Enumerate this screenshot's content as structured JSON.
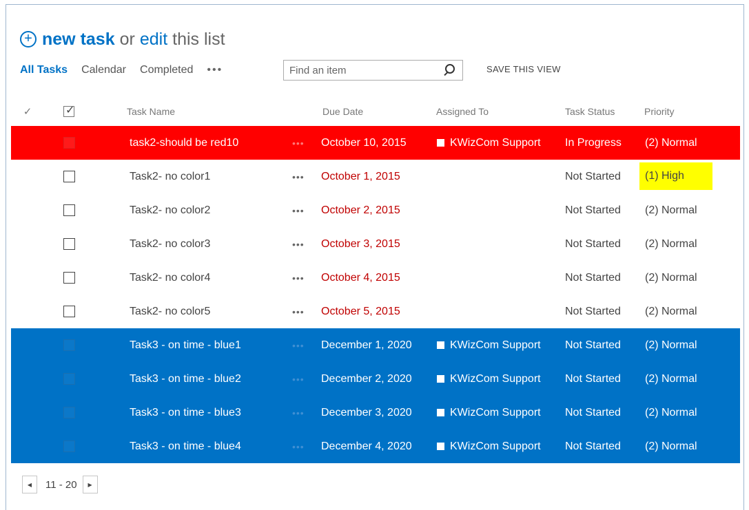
{
  "header": {
    "new_task_label": "new task",
    "or_text": "or",
    "edit_label": "edit",
    "this_list_text": "this list"
  },
  "views": {
    "all_tasks": "All Tasks",
    "calendar": "Calendar",
    "completed": "Completed",
    "more": "•••"
  },
  "search": {
    "placeholder": "Find an item"
  },
  "save_view_label": "SAVE THIS VIEW",
  "columns": {
    "task_name": "Task Name",
    "due_date": "Due Date",
    "assigned_to": "Assigned To",
    "task_status": "Task Status",
    "priority": "Priority"
  },
  "rows": [
    {
      "name": "task2-should be red10",
      "due": "October 10, 2015",
      "assigned": "KWizCom Support",
      "status": "In Progress",
      "priority": "(2) Normal",
      "style": "red"
    },
    {
      "name": "Task2- no color1",
      "due": "October 1, 2015",
      "assigned": "",
      "status": "Not Started",
      "priority": "(1) High",
      "style": "plain",
      "highlight_priority": "#ffff00"
    },
    {
      "name": "Task2- no color2",
      "due": "October 2, 2015",
      "assigned": "",
      "status": "Not Started",
      "priority": "(2) Normal",
      "style": "plain"
    },
    {
      "name": "Task2- no color3",
      "due": "October 3, 2015",
      "assigned": "",
      "status": "Not Started",
      "priority": "(2) Normal",
      "style": "plain"
    },
    {
      "name": "Task2- no color4",
      "due": "October 4, 2015",
      "assigned": "",
      "status": "Not Started",
      "priority": "(2) Normal",
      "style": "plain"
    },
    {
      "name": "Task2- no color5",
      "due": "October 5, 2015",
      "assigned": "",
      "status": "Not Started",
      "priority": "(2) Normal",
      "style": "plain"
    },
    {
      "name": "Task3 - on time - blue1",
      "due": "December 1, 2020",
      "assigned": "KWizCom Support",
      "status": "Not Started",
      "priority": "(2) Normal",
      "style": "blue"
    },
    {
      "name": "Task3 - on time - blue2",
      "due": "December 2, 2020",
      "assigned": "KWizCom Support",
      "status": "Not Started",
      "priority": "(2) Normal",
      "style": "blue"
    },
    {
      "name": "Task3 - on time - blue3",
      "due": "December 3, 2020",
      "assigned": "KWizCom Support",
      "status": "Not Started",
      "priority": "(2) Normal",
      "style": "blue"
    },
    {
      "name": "Task3 - on time - blue4",
      "due": "December 4, 2020",
      "assigned": "KWizCom Support",
      "status": "Not Started",
      "priority": "(2) Normal",
      "style": "blue"
    }
  ],
  "row_menu": "•••",
  "pager": {
    "range": "11 - 20"
  },
  "colors": {
    "accent": "#0072c6",
    "red_row": "#ff0000",
    "blue_row": "#0072c6",
    "overdue_text": "#c00000",
    "high_priority_bg": "#ffff00"
  }
}
